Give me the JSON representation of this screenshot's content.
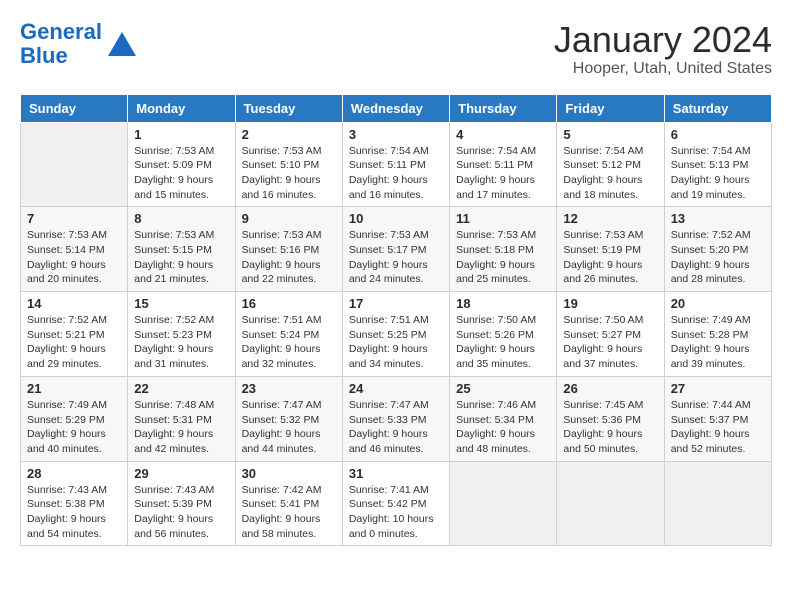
{
  "logo": {
    "line1": "General",
    "line2": "Blue"
  },
  "title": "January 2024",
  "location": "Hooper, Utah, United States",
  "days_of_week": [
    "Sunday",
    "Monday",
    "Tuesday",
    "Wednesday",
    "Thursday",
    "Friday",
    "Saturday"
  ],
  "weeks": [
    [
      {
        "day": "",
        "sunrise": "",
        "sunset": "",
        "daylight": ""
      },
      {
        "day": "1",
        "sunrise": "Sunrise: 7:53 AM",
        "sunset": "Sunset: 5:09 PM",
        "daylight": "Daylight: 9 hours and 15 minutes."
      },
      {
        "day": "2",
        "sunrise": "Sunrise: 7:53 AM",
        "sunset": "Sunset: 5:10 PM",
        "daylight": "Daylight: 9 hours and 16 minutes."
      },
      {
        "day": "3",
        "sunrise": "Sunrise: 7:54 AM",
        "sunset": "Sunset: 5:11 PM",
        "daylight": "Daylight: 9 hours and 16 minutes."
      },
      {
        "day": "4",
        "sunrise": "Sunrise: 7:54 AM",
        "sunset": "Sunset: 5:11 PM",
        "daylight": "Daylight: 9 hours and 17 minutes."
      },
      {
        "day": "5",
        "sunrise": "Sunrise: 7:54 AM",
        "sunset": "Sunset: 5:12 PM",
        "daylight": "Daylight: 9 hours and 18 minutes."
      },
      {
        "day": "6",
        "sunrise": "Sunrise: 7:54 AM",
        "sunset": "Sunset: 5:13 PM",
        "daylight": "Daylight: 9 hours and 19 minutes."
      }
    ],
    [
      {
        "day": "7",
        "sunrise": "Sunrise: 7:53 AM",
        "sunset": "Sunset: 5:14 PM",
        "daylight": "Daylight: 9 hours and 20 minutes."
      },
      {
        "day": "8",
        "sunrise": "Sunrise: 7:53 AM",
        "sunset": "Sunset: 5:15 PM",
        "daylight": "Daylight: 9 hours and 21 minutes."
      },
      {
        "day": "9",
        "sunrise": "Sunrise: 7:53 AM",
        "sunset": "Sunset: 5:16 PM",
        "daylight": "Daylight: 9 hours and 22 minutes."
      },
      {
        "day": "10",
        "sunrise": "Sunrise: 7:53 AM",
        "sunset": "Sunset: 5:17 PM",
        "daylight": "Daylight: 9 hours and 24 minutes."
      },
      {
        "day": "11",
        "sunrise": "Sunrise: 7:53 AM",
        "sunset": "Sunset: 5:18 PM",
        "daylight": "Daylight: 9 hours and 25 minutes."
      },
      {
        "day": "12",
        "sunrise": "Sunrise: 7:53 AM",
        "sunset": "Sunset: 5:19 PM",
        "daylight": "Daylight: 9 hours and 26 minutes."
      },
      {
        "day": "13",
        "sunrise": "Sunrise: 7:52 AM",
        "sunset": "Sunset: 5:20 PM",
        "daylight": "Daylight: 9 hours and 28 minutes."
      }
    ],
    [
      {
        "day": "14",
        "sunrise": "Sunrise: 7:52 AM",
        "sunset": "Sunset: 5:21 PM",
        "daylight": "Daylight: 9 hours and 29 minutes."
      },
      {
        "day": "15",
        "sunrise": "Sunrise: 7:52 AM",
        "sunset": "Sunset: 5:23 PM",
        "daylight": "Daylight: 9 hours and 31 minutes."
      },
      {
        "day": "16",
        "sunrise": "Sunrise: 7:51 AM",
        "sunset": "Sunset: 5:24 PM",
        "daylight": "Daylight: 9 hours and 32 minutes."
      },
      {
        "day": "17",
        "sunrise": "Sunrise: 7:51 AM",
        "sunset": "Sunset: 5:25 PM",
        "daylight": "Daylight: 9 hours and 34 minutes."
      },
      {
        "day": "18",
        "sunrise": "Sunrise: 7:50 AM",
        "sunset": "Sunset: 5:26 PM",
        "daylight": "Daylight: 9 hours and 35 minutes."
      },
      {
        "day": "19",
        "sunrise": "Sunrise: 7:50 AM",
        "sunset": "Sunset: 5:27 PM",
        "daylight": "Daylight: 9 hours and 37 minutes."
      },
      {
        "day": "20",
        "sunrise": "Sunrise: 7:49 AM",
        "sunset": "Sunset: 5:28 PM",
        "daylight": "Daylight: 9 hours and 39 minutes."
      }
    ],
    [
      {
        "day": "21",
        "sunrise": "Sunrise: 7:49 AM",
        "sunset": "Sunset: 5:29 PM",
        "daylight": "Daylight: 9 hours and 40 minutes."
      },
      {
        "day": "22",
        "sunrise": "Sunrise: 7:48 AM",
        "sunset": "Sunset: 5:31 PM",
        "daylight": "Daylight: 9 hours and 42 minutes."
      },
      {
        "day": "23",
        "sunrise": "Sunrise: 7:47 AM",
        "sunset": "Sunset: 5:32 PM",
        "daylight": "Daylight: 9 hours and 44 minutes."
      },
      {
        "day": "24",
        "sunrise": "Sunrise: 7:47 AM",
        "sunset": "Sunset: 5:33 PM",
        "daylight": "Daylight: 9 hours and 46 minutes."
      },
      {
        "day": "25",
        "sunrise": "Sunrise: 7:46 AM",
        "sunset": "Sunset: 5:34 PM",
        "daylight": "Daylight: 9 hours and 48 minutes."
      },
      {
        "day": "26",
        "sunrise": "Sunrise: 7:45 AM",
        "sunset": "Sunset: 5:36 PM",
        "daylight": "Daylight: 9 hours and 50 minutes."
      },
      {
        "day": "27",
        "sunrise": "Sunrise: 7:44 AM",
        "sunset": "Sunset: 5:37 PM",
        "daylight": "Daylight: 9 hours and 52 minutes."
      }
    ],
    [
      {
        "day": "28",
        "sunrise": "Sunrise: 7:43 AM",
        "sunset": "Sunset: 5:38 PM",
        "daylight": "Daylight: 9 hours and 54 minutes."
      },
      {
        "day": "29",
        "sunrise": "Sunrise: 7:43 AM",
        "sunset": "Sunset: 5:39 PM",
        "daylight": "Daylight: 9 hours and 56 minutes."
      },
      {
        "day": "30",
        "sunrise": "Sunrise: 7:42 AM",
        "sunset": "Sunset: 5:41 PM",
        "daylight": "Daylight: 9 hours and 58 minutes."
      },
      {
        "day": "31",
        "sunrise": "Sunrise: 7:41 AM",
        "sunset": "Sunset: 5:42 PM",
        "daylight": "Daylight: 10 hours and 0 minutes."
      },
      {
        "day": "",
        "sunrise": "",
        "sunset": "",
        "daylight": ""
      },
      {
        "day": "",
        "sunrise": "",
        "sunset": "",
        "daylight": ""
      },
      {
        "day": "",
        "sunrise": "",
        "sunset": "",
        "daylight": ""
      }
    ]
  ]
}
